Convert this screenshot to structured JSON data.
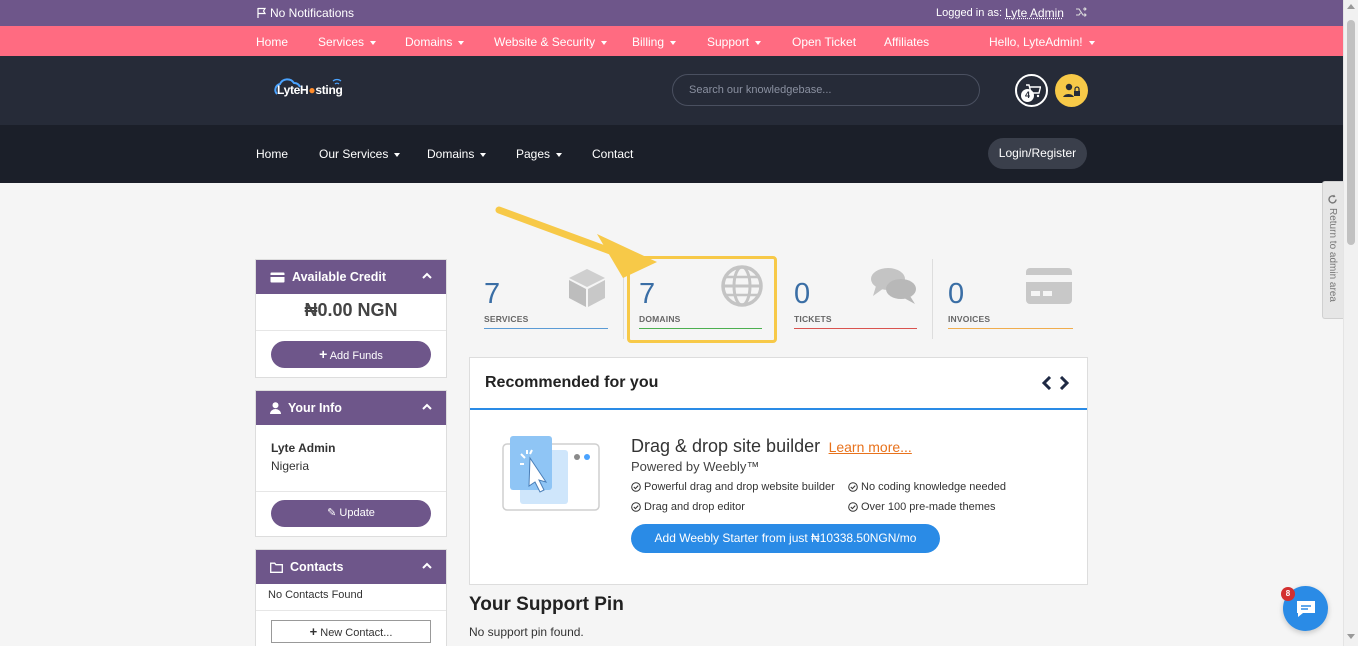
{
  "notifications": {
    "text": "No Notifications"
  },
  "admin": {
    "logged_in_label": "Logged in as:",
    "name": "Lyte Admin"
  },
  "client_nav": {
    "items": [
      "Home",
      "Services",
      "Domains",
      "Website & Security",
      "Billing",
      "Support",
      "Open Ticket",
      "Affiliates"
    ],
    "greeting": "Hello, LyteAdmin!"
  },
  "brand": {
    "logo_text_a": "Lyte",
    "logo_text_b": "H",
    "logo_text_c": "sting"
  },
  "search": {
    "placeholder": "Search our knowledgebase..."
  },
  "cart": {
    "count": "4"
  },
  "main_nav": {
    "items": [
      "Home",
      "Our Services",
      "Domains",
      "Pages",
      "Contact"
    ],
    "login_button": "Login/Register"
  },
  "return_tab": {
    "label": "Return to admin area"
  },
  "sidebar": {
    "credit": {
      "title": "Available Credit",
      "amount": "₦0.00 NGN",
      "button": "Add Funds"
    },
    "info": {
      "title": "Your Info",
      "name": "Lyte Admin",
      "country": "Nigeria",
      "button": "Update"
    },
    "contacts": {
      "title": "Contacts",
      "empty": "No Contacts Found",
      "button": "New Contact..."
    }
  },
  "stats": [
    {
      "value": "7",
      "label": "SERVICES",
      "color": "#5b9bd5"
    },
    {
      "value": "7",
      "label": "DOMAINS",
      "color": "#4caf50"
    },
    {
      "value": "0",
      "label": "TICKETS",
      "color": "#d9534f"
    },
    {
      "value": "0",
      "label": "INVOICES",
      "color": "#f0ad4e"
    }
  ],
  "recommended": {
    "title": "Recommended for you",
    "product_title": "Drag & drop site builder",
    "learn_more": "Learn more...",
    "powered_by": "Powered by Weebly™",
    "features": [
      "Powerful drag and drop website builder",
      "No coding knowledge needed",
      "Drag and drop editor",
      "Over 100 pre-made themes"
    ],
    "cta": "Add Weebly Starter from just ₦10338.50NGN/mo"
  },
  "support_pin": {
    "title": "Your Support Pin",
    "text": "No support pin found."
  },
  "chat": {
    "badge": "8"
  },
  "colors": {
    "purple": "#6e568a",
    "pink": "#ff6b81",
    "highlight": "#f7c948",
    "primary_blue": "#2a8be6"
  }
}
